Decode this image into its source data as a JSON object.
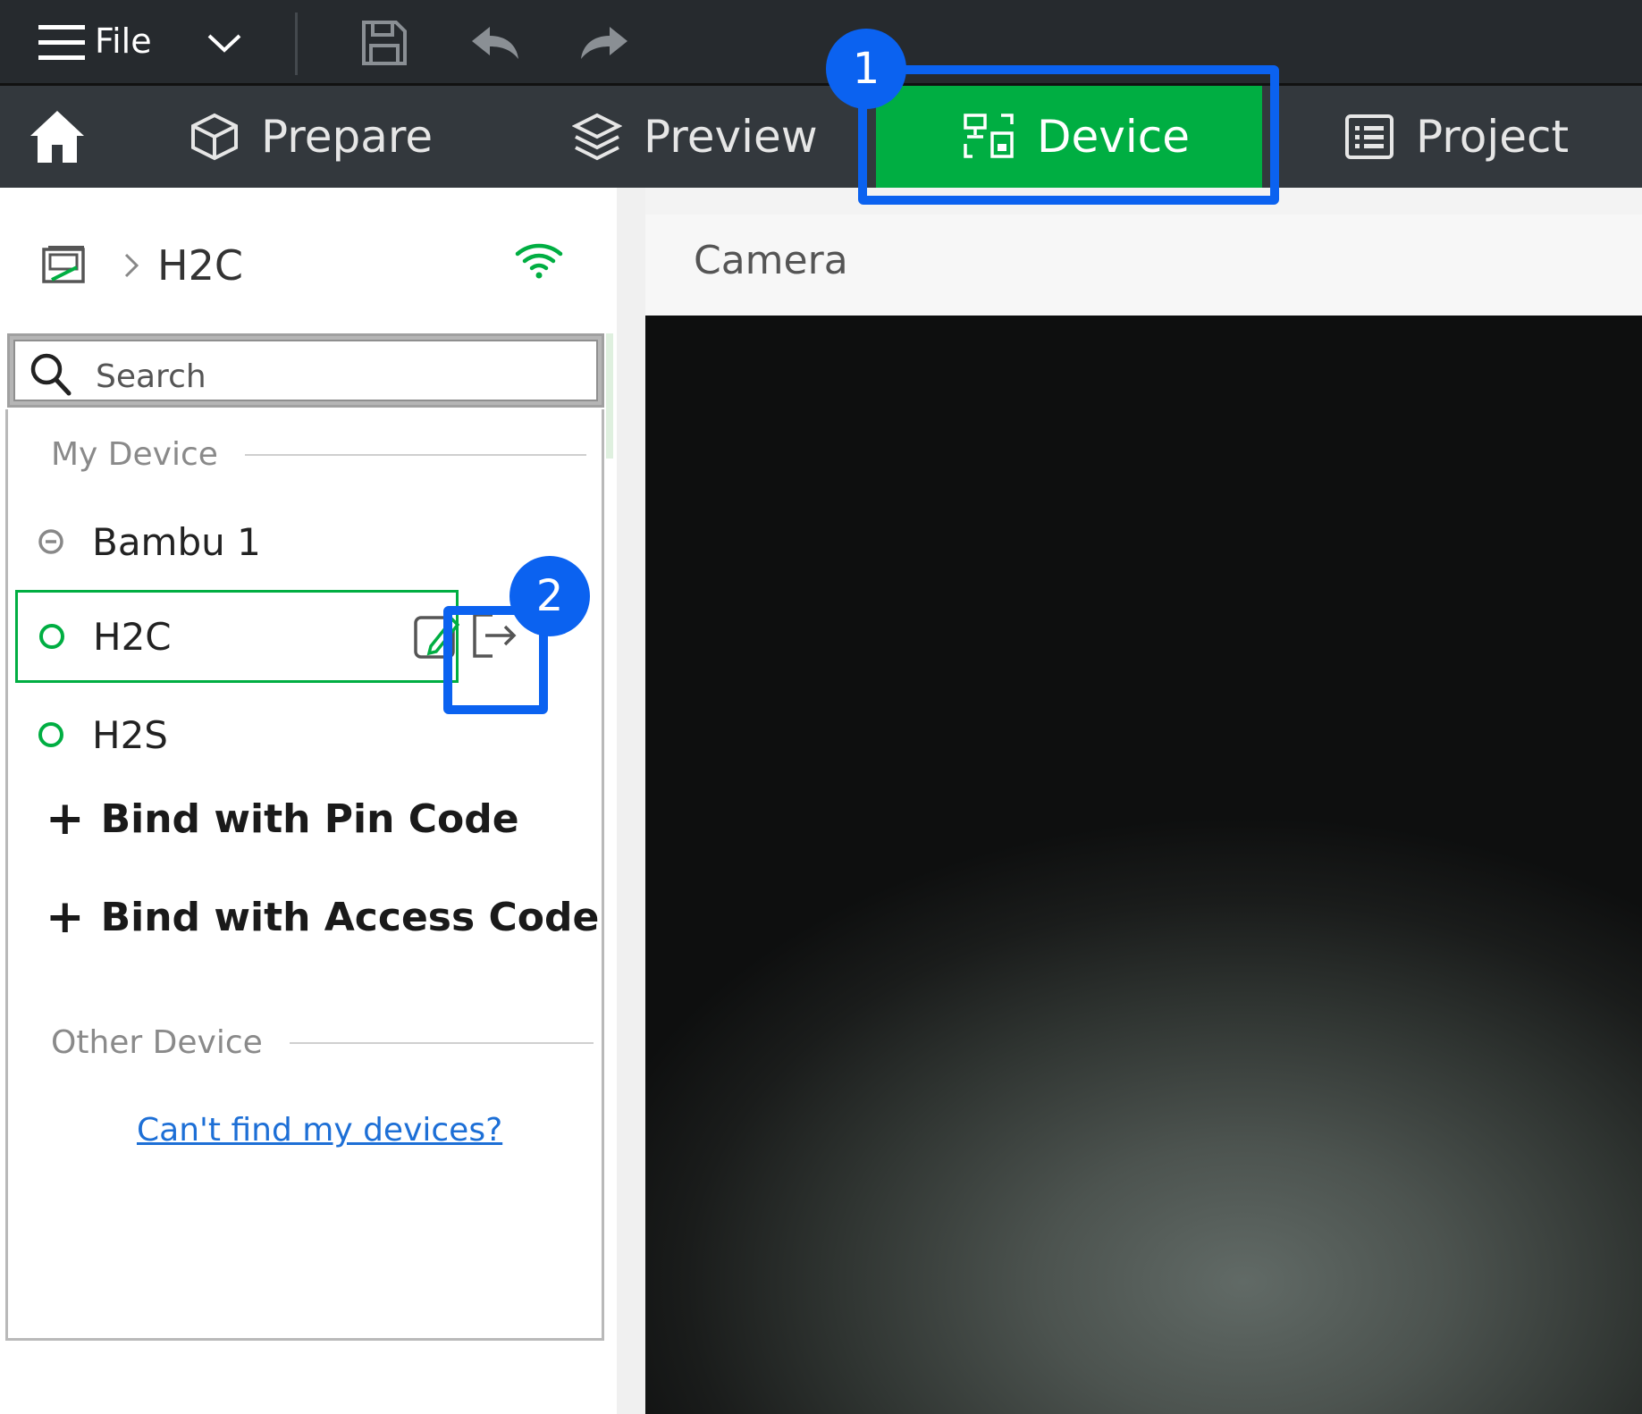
{
  "menubar": {
    "file_label": "File"
  },
  "tabs": [
    {
      "label": "Prepare"
    },
    {
      "label": "Preview"
    },
    {
      "label": "Device"
    },
    {
      "label": "Project"
    }
  ],
  "sidebar": {
    "breadcrumb_title": "H2C",
    "search_placeholder": "Search",
    "my_device_heading": "My Device",
    "devices": [
      {
        "name": "Bambu 1"
      },
      {
        "name": "H2C"
      },
      {
        "name": "H2S"
      }
    ],
    "bind_pin": "Bind with Pin Code",
    "bind_access": "Bind with Access Code",
    "other_device_heading": "Other Device",
    "cant_find_link": "Can't find my devices?"
  },
  "main": {
    "camera_title": "Camera"
  },
  "annotations": {
    "badge1": "1",
    "badge2": "2"
  },
  "colors": {
    "accent_green": "#00ae42",
    "annotation_blue": "#0b62f0"
  }
}
